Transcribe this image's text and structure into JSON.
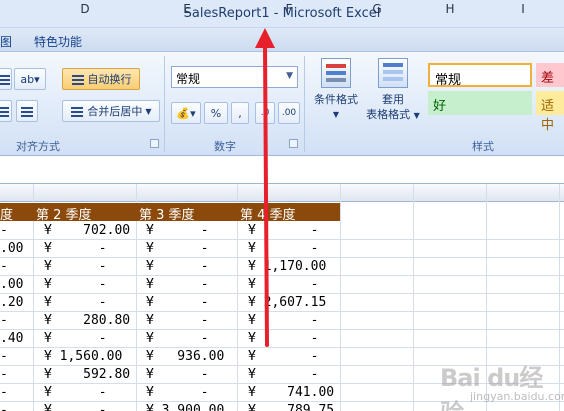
{
  "window": {
    "title": "SalesReport1 - Microsoft Excel"
  },
  "menu": {
    "items": [
      "图",
      "特色功能"
    ]
  },
  "ribbon": {
    "wrap_text_label": "自动换行",
    "merge_center_label": "合并后居中",
    "alignment_group_label": "对齐方式",
    "number_format_value": "常规",
    "percent_label": "%",
    "comma_label": ",",
    "number_group_label": "数字",
    "conditional_format_label": "条件格式",
    "table_format_label_1": "套用",
    "table_format_label_2": "表格格式",
    "styles_group_label": "样式",
    "style_normal": "常规",
    "style_bad": "差",
    "style_good": "好",
    "style_neutral": "适中",
    "decrease_decimal_label": ".0",
    "increase_decimal_label": ".00"
  },
  "sheet": {
    "column_headers": [
      "D",
      "E",
      "F",
      "G",
      "H",
      "I"
    ],
    "quarter_headers": [
      "度",
      "第 2 季度",
      "第 3 季度",
      "第 4 季度"
    ],
    "rows": [
      [
        "-",
        "¥    702.00",
        "¥      -",
        "¥       -"
      ],
      [
        ".00",
        "¥      -",
        "¥      -",
        "¥       -"
      ],
      [
        "-",
        "¥      -",
        "¥      -",
        "¥ 1,170.00"
      ],
      [
        ".00",
        "¥      -",
        "¥      -",
        "¥       -"
      ],
      [
        ".20",
        "¥      -",
        "¥      -",
        "¥ 2,607.15"
      ],
      [
        "-",
        "¥    280.80",
        "¥      -",
        "¥       -"
      ],
      [
        ".40",
        "¥      -",
        "¥      -",
        "¥       -"
      ],
      [
        "-",
        "¥ 1,560.00",
        "¥   936.00",
        "¥       -"
      ],
      [
        "-",
        "¥    592.80",
        "¥      -",
        "¥       -"
      ],
      [
        "-",
        "¥      -",
        "¥      -",
        "¥    741.00"
      ],
      [
        "-",
        "¥      -",
        "¥ 3,900.00",
        "¥    789.75"
      ]
    ]
  },
  "watermark": {
    "main": "Bai du经验",
    "sub": "jingyan.baidu.com"
  }
}
